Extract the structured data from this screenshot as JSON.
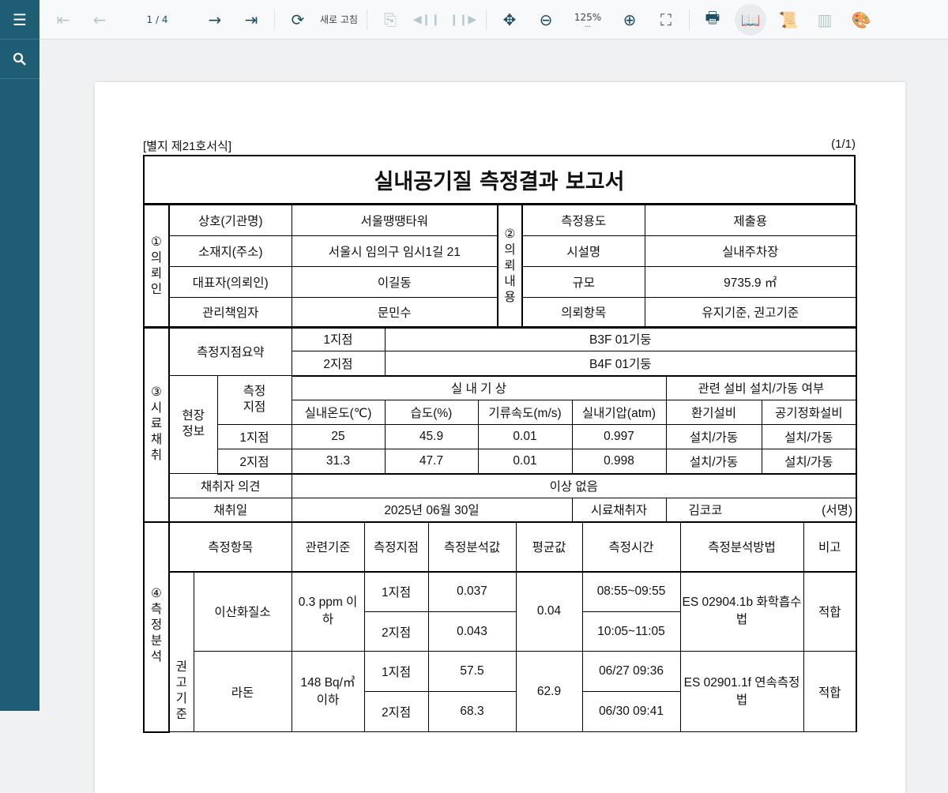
{
  "toolbar": {
    "page_indicator": "1 / 4",
    "refresh_label": "새로 고침",
    "zoom_level": "125%",
    "zoom_more": "..."
  },
  "doc": {
    "form_label": "[별지 제21호서식]",
    "page_count": "(1/1)",
    "title": "실내공기질 측정결과 보고서",
    "requester": {
      "label": "①의뢰인",
      "rows": [
        [
          "상호(기관명)",
          "서울땡땡타워"
        ],
        [
          "소재지(주소)",
          "서울시 임의구 임시1길 21"
        ],
        [
          "대표자(의뢰인)",
          "이길동"
        ],
        [
          "관리책임자",
          "문민수"
        ]
      ]
    },
    "request": {
      "label": "②의뢰내용",
      "rows": [
        [
          "측정용도",
          "제출용"
        ],
        [
          "시설명",
          "실내주차장"
        ],
        [
          "규모",
          "9735.9 ㎡"
        ],
        [
          "의뢰항목",
          "유지기준, 권고기준"
        ]
      ]
    },
    "sampling": {
      "label": "③시료채취",
      "summary_label": "측정지점요약",
      "points": [
        [
          "1지점",
          "B3F 01기둥"
        ],
        [
          "2지점",
          "B4F 01기둥"
        ]
      ],
      "site_label": "현장정보",
      "point_col": "측정지점",
      "weather_group": "실 내 기 상",
      "equip_group": "관련 설비 설치/가동 여부",
      "cols": [
        "실내온도(℃)",
        "습도(%)",
        "기류속도(m/s)",
        "실내기압(atm)",
        "환기설비",
        "공기정화설비"
      ],
      "rows": [
        [
          "1지점",
          "25",
          "45.9",
          "0.01",
          "0.997",
          "설치/가동",
          "설치/가동"
        ],
        [
          "2지점",
          "31.3",
          "47.7",
          "0.01",
          "0.998",
          "설치/가동",
          "설치/가동"
        ]
      ],
      "opinion_label": "채취자 의견",
      "opinion": "이상 없음",
      "date_label": "채취일",
      "date": "2025년 06월 30일",
      "sampler_label": "시료채취자",
      "sampler": "김코코",
      "sign": "(서명)"
    },
    "analysis": {
      "label": "④측정분석",
      "group_label": "권고기준",
      "headers": [
        "측정항목",
        "관련기준",
        "측정지점",
        "측정분석값",
        "평균값",
        "측정시간",
        "측정분석방법",
        "비고"
      ],
      "items": [
        {
          "name": "이산화질소",
          "standard": "0.3 ppm 이하",
          "points": [
            [
              "1지점",
              "0.037",
              "08:55~09:55"
            ],
            [
              "2지점",
              "0.043",
              "10:05~11:05"
            ]
          ],
          "avg": "0.04",
          "method": "ES 02904.1b 화학흡수법",
          "result": "적합"
        },
        {
          "name": "라돈",
          "standard": "148 Bq/㎥ 이하",
          "points": [
            [
              "1지점",
              "57.5",
              "06/27 09:36"
            ],
            [
              "2지점",
              "68.3",
              "06/30 09:41"
            ]
          ],
          "avg": "62.9",
          "method": "ES 02901.1f 연속측정법",
          "result": "적합"
        }
      ]
    }
  }
}
